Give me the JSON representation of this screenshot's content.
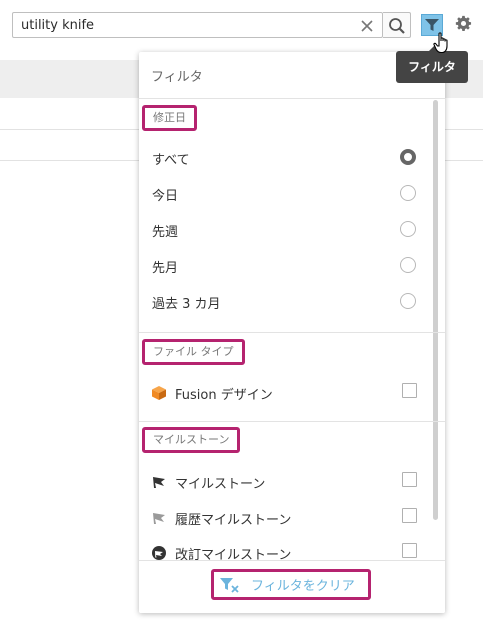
{
  "search": {
    "value": "utility knife"
  },
  "toolbar": {
    "filter_tooltip": "フィルタ"
  },
  "filter_panel": {
    "title": "フィルタ",
    "sections": {
      "modified": {
        "label": "修正日",
        "options": [
          {
            "label": "すべて",
            "selected": true
          },
          {
            "label": "今日",
            "selected": false
          },
          {
            "label": "先週",
            "selected": false
          },
          {
            "label": "先月",
            "selected": false
          },
          {
            "label": "過去 3 カ月",
            "selected": false
          }
        ]
      },
      "file_type": {
        "label": "ファイル タイプ",
        "options": [
          {
            "label": "Fusion デザイン",
            "icon": "fusion-design-icon",
            "checked": false
          }
        ]
      },
      "milestone": {
        "label": "マイルストーン",
        "options": [
          {
            "label": "マイルストーン",
            "icon": "milestone-flag-icon",
            "checked": false
          },
          {
            "label": "履歴マイルストーン",
            "icon": "history-milestone-flag-icon",
            "checked": false
          },
          {
            "label": "改訂マイルストーン",
            "icon": "revision-milestone-icon",
            "checked": false
          }
        ]
      }
    },
    "clear_label": "フィルタをクリア"
  },
  "colors": {
    "highlight": "#b5236f",
    "accent": "#6bb4dd",
    "filter_active": "#7fc3e8",
    "fusion_orange": "#f08a24"
  }
}
